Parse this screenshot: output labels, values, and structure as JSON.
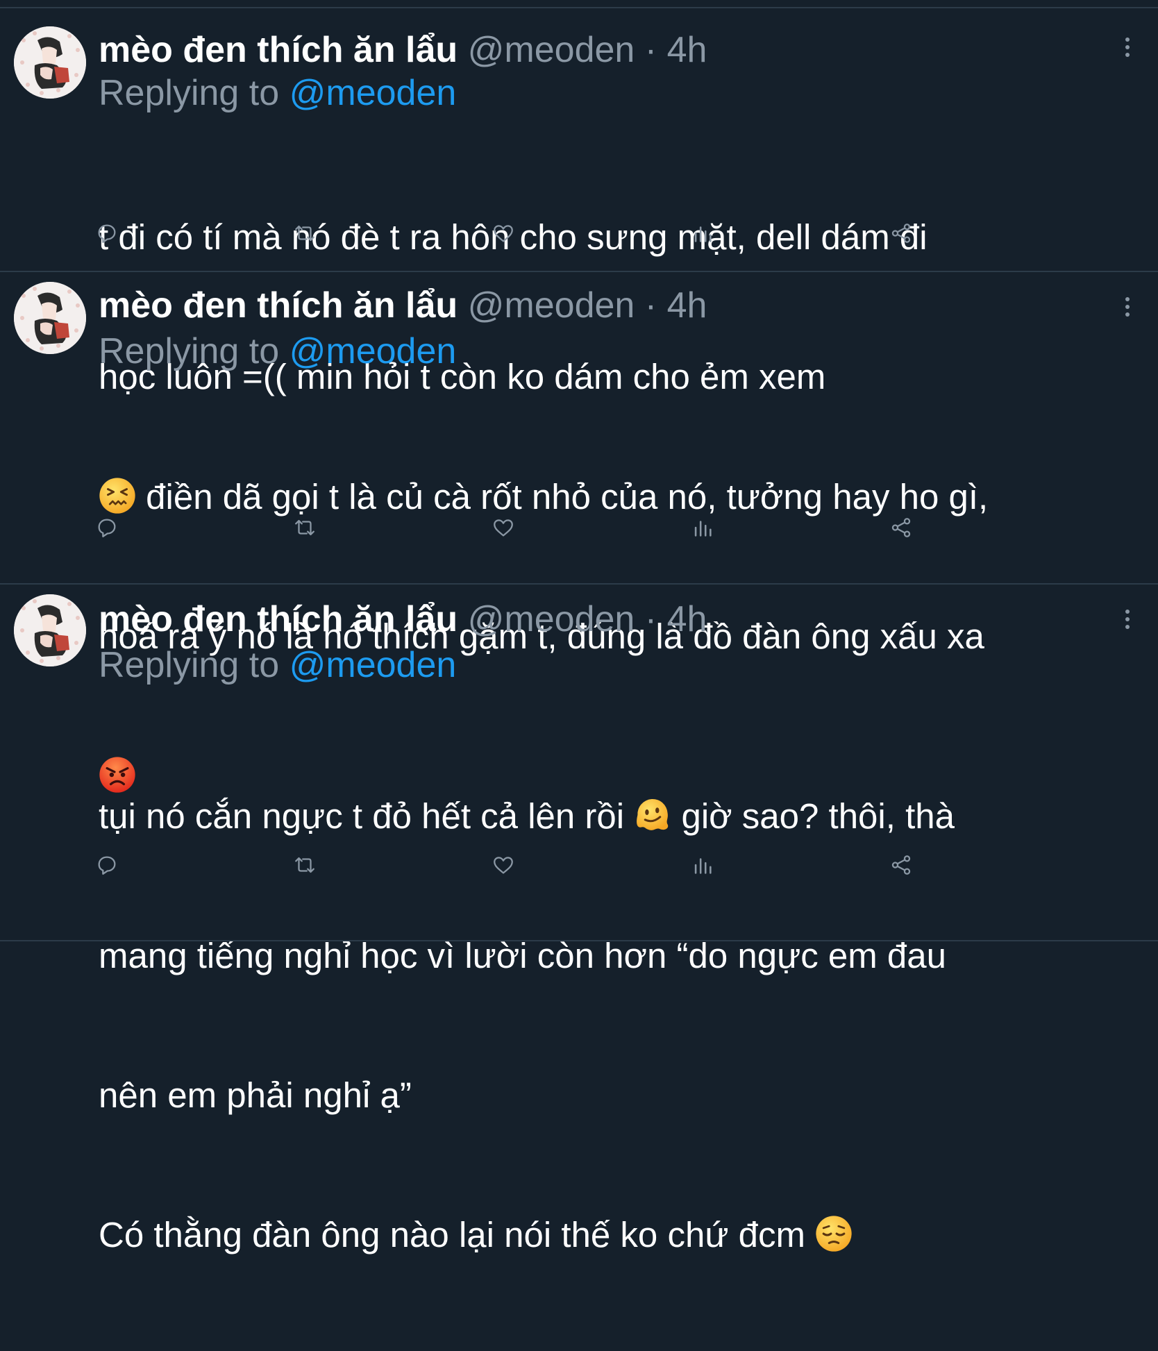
{
  "colors": {
    "background": "#15202b",
    "separator": "#2c3b49",
    "text_primary": "#ffffff",
    "text_secondary": "#8b98a5",
    "mention": "#1d9bf0"
  },
  "tweets": [
    {
      "display_name": "mèo đen thích ăn lẩu",
      "handle": "@meoden",
      "dot": "·",
      "time": "4h",
      "replying_prefix": "Replying to",
      "replying_handle": "@meoden",
      "text_line1": "t đi có tí mà nó đè t ra hôn cho sưng mặt, dell dám đi",
      "text_line2": "học luôn =(( min hỏi t còn ko dám cho ẻm xem",
      "icons": [
        "reply-icon",
        "retweet-icon",
        "like-icon",
        "views-icon",
        "share-icon"
      ]
    },
    {
      "display_name": "mèo đen thích ăn lẩu",
      "handle": "@meoden",
      "dot": "·",
      "time": "4h",
      "replying_prefix": "Replying to",
      "replying_handle": "@meoden",
      "text_line1": " điền dã gọi t là củ cà rốt nhỏ của nó, tưởng hay ho gì,",
      "text_line2": "hoá ra ý nó là nó thích gặm t, đúng là đồ đàn ông xấu xa",
      "emoji_1": "confounded-face-emoji",
      "emoji_2": "angry-face-emoji",
      "icons": [
        "reply-icon",
        "retweet-icon",
        "like-icon",
        "views-icon",
        "share-icon"
      ]
    },
    {
      "display_name": "mèo đen thích ăn lẩu",
      "handle": "@meoden",
      "dot": "·",
      "time": "4h",
      "replying_prefix": "Replying to",
      "replying_handle": "@meoden",
      "text_line1a": "tụi nó cắn ngực t đỏ hết cả lên rồi ",
      "text_line1b": " giờ sao? thôi, thà",
      "text_line2": "mang tiếng nghỉ học vì lười còn hơn “do ngực em đau",
      "text_line3": "nên em phải nghỉ ạ”",
      "text_line4": "Có thằng đàn ông nào lại nói thế ko chứ đcm ",
      "emoji_1": "melting-face-emoji",
      "emoji_2": "pensive-face-emoji",
      "icons": [
        "reply-icon",
        "retweet-icon",
        "like-icon",
        "views-icon",
        "share-icon"
      ]
    }
  ]
}
